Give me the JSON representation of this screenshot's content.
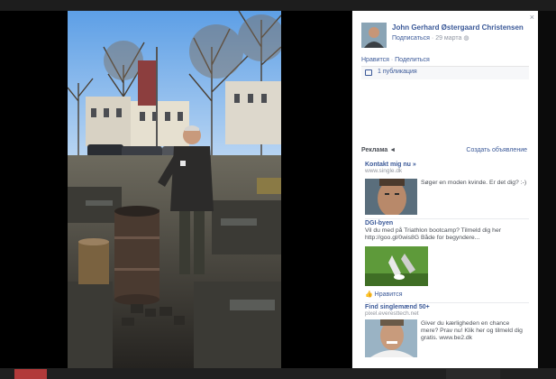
{
  "lightbox": {
    "close_glyph": "×"
  },
  "post": {
    "author_name": "John Gerhard Østergaard Christensen",
    "subscribe_label": "Подписаться",
    "date": "29 марта",
    "like_label": "Нравится",
    "separator": "·",
    "share_label": "Поделиться",
    "publications_count": "1 публикация"
  },
  "ads": {
    "header": "Реклама",
    "create_ad": "Создать объявление",
    "items": [
      {
        "title": "Kontakt mig nu »",
        "url": "www.single.dk",
        "text": "Søger en moden kvinde. Er det dig? :-)"
      },
      {
        "title": "DGI-byen",
        "url": "",
        "text": "Vil du med på Triathlon bootcamp? Tilmeld dig her http://goo.gl/0wis8G Både for begyndere...",
        "like_label": "Нравится"
      },
      {
        "title": "Find singlemænd 50+",
        "url": "pixel.everesttech.net",
        "text": "Giver du kærligheden en chance mere? Prav nu! Klik her og tilmeld dig gratis. www.be2.dk"
      }
    ]
  }
}
